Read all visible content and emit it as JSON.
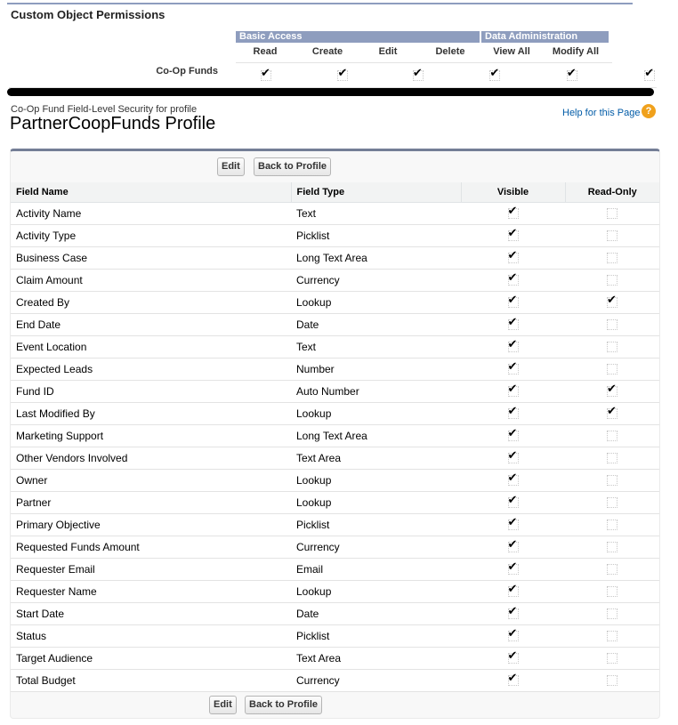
{
  "custom_object_permissions": {
    "title": "Custom Object Permissions",
    "groups": [
      {
        "label": "Basic Access"
      },
      {
        "label": "Data Administration"
      }
    ],
    "columns": [
      "Read",
      "Create",
      "Edit",
      "Delete",
      "View All",
      "Modify All"
    ],
    "row": {
      "label": "Co-Op Funds",
      "values": [
        true,
        true,
        true,
        true,
        true,
        true
      ]
    }
  },
  "header": {
    "subtitle": "Co-Op Fund Field-Level Security for profile",
    "title": "PartnerCoopFunds Profile",
    "help_link": "Help for this Page",
    "help_icon": "question-icon"
  },
  "buttons": {
    "edit": "Edit",
    "back": "Back to Profile"
  },
  "table": {
    "headers": [
      "Field Name",
      "Field Type",
      "Visible",
      "Read-Only"
    ],
    "rows": [
      {
        "name": "Activity Name",
        "type": "Text",
        "visible": true,
        "readonly": false
      },
      {
        "name": "Activity Type",
        "type": "Picklist",
        "visible": true,
        "readonly": false
      },
      {
        "name": "Business Case",
        "type": "Long Text Area",
        "visible": true,
        "readonly": false
      },
      {
        "name": "Claim Amount",
        "type": "Currency",
        "visible": true,
        "readonly": false
      },
      {
        "name": "Created By",
        "type": "Lookup",
        "visible": true,
        "readonly": true
      },
      {
        "name": "End Date",
        "type": "Date",
        "visible": true,
        "readonly": false
      },
      {
        "name": "Event Location",
        "type": "Text",
        "visible": true,
        "readonly": false
      },
      {
        "name": "Expected Leads",
        "type": "Number",
        "visible": true,
        "readonly": false
      },
      {
        "name": "Fund ID",
        "type": "Auto Number",
        "visible": true,
        "readonly": true
      },
      {
        "name": "Last Modified By",
        "type": "Lookup",
        "visible": true,
        "readonly": true
      },
      {
        "name": "Marketing Support",
        "type": "Long Text Area",
        "visible": true,
        "readonly": false
      },
      {
        "name": "Other Vendors Involved",
        "type": "Text Area",
        "visible": true,
        "readonly": false
      },
      {
        "name": "Owner",
        "type": "Lookup",
        "visible": true,
        "readonly": false
      },
      {
        "name": "Partner",
        "type": "Lookup",
        "visible": true,
        "readonly": false
      },
      {
        "name": "Primary Objective",
        "type": "Picklist",
        "visible": true,
        "readonly": false
      },
      {
        "name": "Requested Funds Amount",
        "type": "Currency",
        "visible": true,
        "readonly": false
      },
      {
        "name": "Requester Email",
        "type": "Email",
        "visible": true,
        "readonly": false
      },
      {
        "name": "Requester Name",
        "type": "Lookup",
        "visible": true,
        "readonly": false
      },
      {
        "name": "Start Date",
        "type": "Date",
        "visible": true,
        "readonly": false
      },
      {
        "name": "Status",
        "type": "Picklist",
        "visible": true,
        "readonly": false
      },
      {
        "name": "Target Audience",
        "type": "Text Area",
        "visible": true,
        "readonly": false
      },
      {
        "name": "Total Budget",
        "type": "Currency",
        "visible": true,
        "readonly": false
      }
    ]
  },
  "colors": {
    "group_header": "#8e9dbe",
    "panel_border": "#747e96",
    "help_link": "#015ba7",
    "help_icon": "#f0a11c"
  }
}
